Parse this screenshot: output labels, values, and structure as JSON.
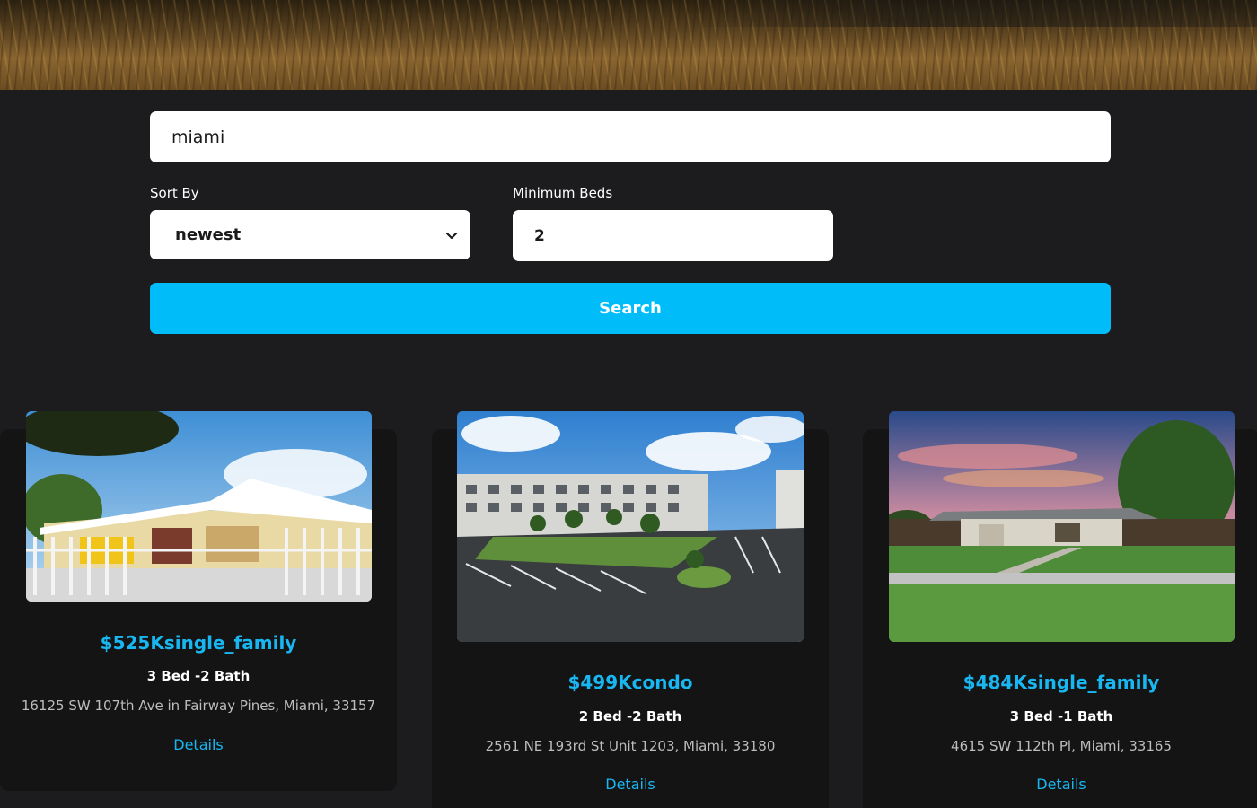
{
  "search": {
    "query": "miami"
  },
  "filters": {
    "sort_label": "Sort By",
    "sort_value": "newest",
    "beds_label": "Minimum Beds",
    "beds_value": "2"
  },
  "search_button_label": "Search",
  "colors": {
    "accent": "#00bdfa",
    "price": "#19b7f2",
    "background": "#1c1c1e",
    "card": "#141414"
  },
  "listings": [
    {
      "price": "$525Ksingle_family",
      "beds_baths": "3 Bed -2 Bath",
      "address": "16125 SW 107th Ave in Fairway Pines, Miami, 33157",
      "details_label": "Details"
    },
    {
      "price": "$499Kcondo",
      "beds_baths": "2 Bed -2 Bath",
      "address": "2561 NE 193rd St Unit 1203, Miami, 33180",
      "details_label": "Details"
    },
    {
      "price": "$484Ksingle_family",
      "beds_baths": "3 Bed -1 Bath",
      "address": "4615 SW 112th Pl, Miami, 33165",
      "details_label": "Details"
    }
  ]
}
